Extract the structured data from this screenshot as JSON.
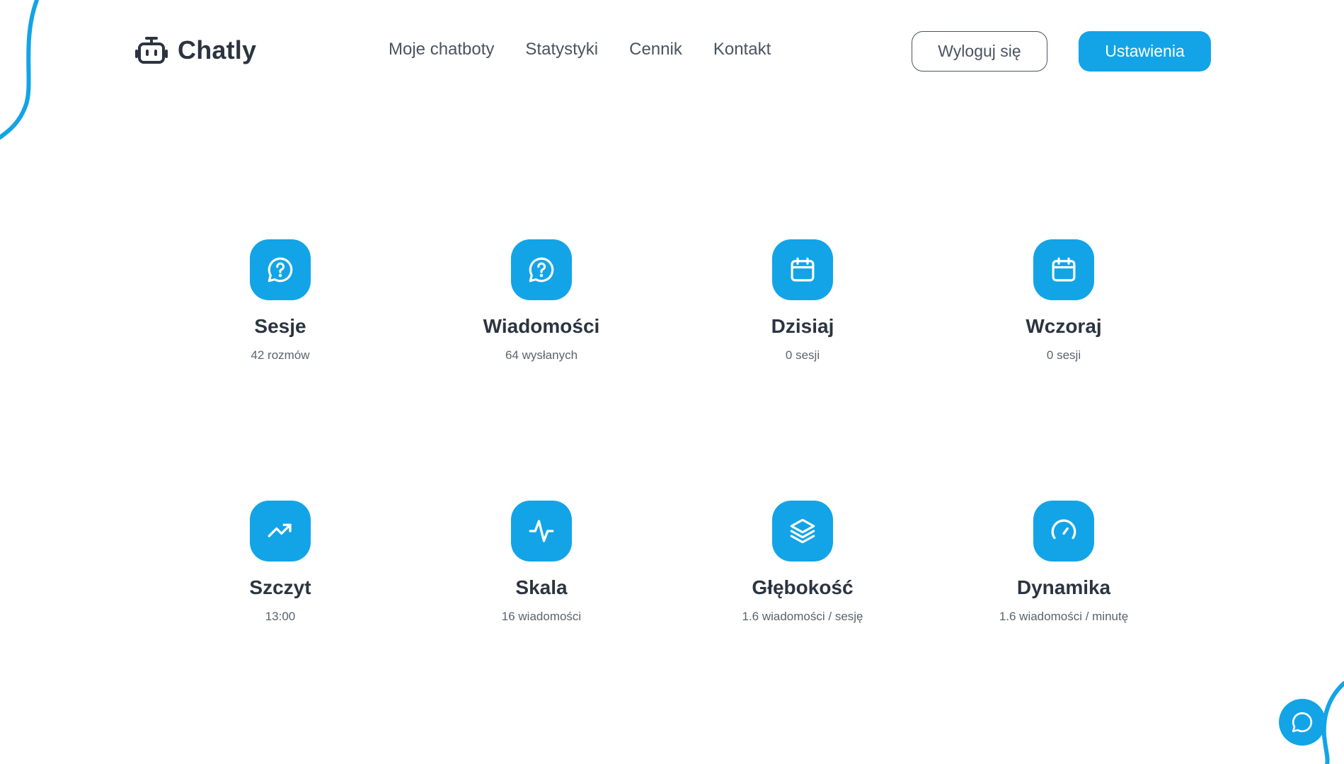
{
  "brand": {
    "name": "Chatly",
    "accent_color": "#12a4e6",
    "text_color": "#2b3440"
  },
  "nav": {
    "items": [
      {
        "label": "Moje chatboty"
      },
      {
        "label": "Statystyki"
      },
      {
        "label": "Cennik"
      },
      {
        "label": "Kontakt"
      }
    ]
  },
  "header": {
    "logout_label": "Wyloguj się",
    "settings_label": "Ustawienia"
  },
  "stats": [
    {
      "title": "Sesje",
      "subtitle": "42 rozmów",
      "icon": "message-question-icon"
    },
    {
      "title": "Wiadomości",
      "subtitle": "64 wysłanych",
      "icon": "message-question-icon"
    },
    {
      "title": "Dzisiaj",
      "subtitle": "0 sesji",
      "icon": "calendar-icon"
    },
    {
      "title": "Wczoraj",
      "subtitle": "0 sesji",
      "icon": "calendar-icon"
    },
    {
      "title": "Szczyt",
      "subtitle": "13:00",
      "icon": "trending-up-icon"
    },
    {
      "title": "Skala",
      "subtitle": "16 wiadomości",
      "icon": "activity-icon"
    },
    {
      "title": "Głębokość",
      "subtitle": "1.6 wiadomości / sesję",
      "icon": "layers-icon"
    },
    {
      "title": "Dynamika",
      "subtitle": "1.6 wiadomości / minutę",
      "icon": "gauge-icon"
    }
  ],
  "chat_widget": {
    "icon": "chat-bubble-icon"
  }
}
